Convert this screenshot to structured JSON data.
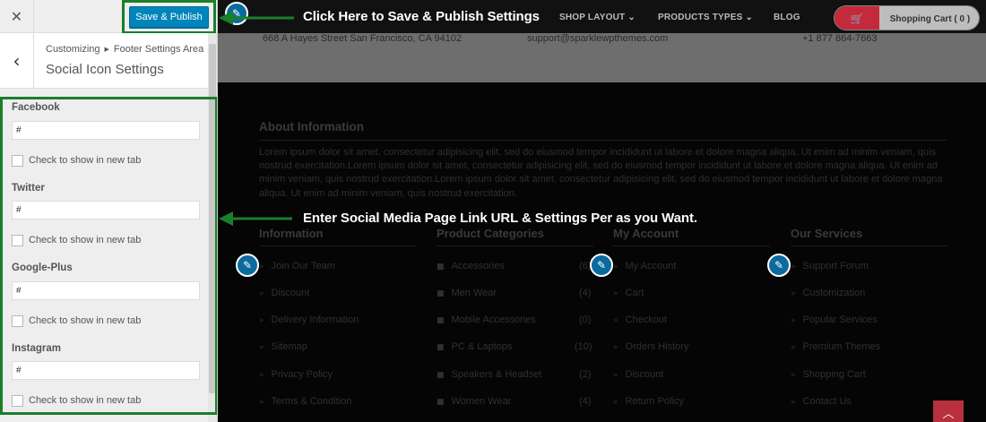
{
  "customizer": {
    "close_icon": "close-icon",
    "save_label": "Save & Publish",
    "breadcrumb": {
      "parent": "Customizing",
      "separator_icon": "triangle-right-icon",
      "section": "Footer Settings Area"
    },
    "section_title": "Social Icon Settings",
    "fields": [
      {
        "label": "Facebook",
        "value": "#",
        "checkbox_label": "Check to show in new tab"
      },
      {
        "label": "Twitter",
        "value": "#",
        "checkbox_label": "Check to show in new tab"
      },
      {
        "label": "Google-Plus",
        "value": "#",
        "checkbox_label": "Check to show in new tab"
      },
      {
        "label": "Instagram",
        "value": "#",
        "checkbox_label": "Check to show in new tab"
      }
    ]
  },
  "preview": {
    "nav": [
      "SHOP LAYOUT",
      "PRODUCTS TYPES",
      "BLOG"
    ],
    "cart_label": "Shopping Cart ( 0 )",
    "contact": {
      "address": "668 A Hayes Street San Francisco, CA 94102",
      "email": "support@sparklewpthemes.com",
      "phone": "+1 877 864-7663"
    },
    "about": {
      "title": "About Information",
      "text": "Lorem ipsum dolor sit amet, consectetur adipisicing elit, sed do eiusmod tempor incididunt ut labore et dolore magna aliqua. Ut enim ad minim veniam, quis nostrud exercitation.Lorem ipsum dolor sit amet, consectetur adipisicing elit, sed do eiusmod tempor incididunt ut labore et dolore magna aliqua. Ut enim ad minim veniam, quis nostrud exercitation.Lorem ipsum dolor sit amet, consectetur adipisicing elit, sed do eiusmod tempor incididunt ut labore et dolore magna aliqua. Ut enim ad minim veniam, quis nostrud exercitation."
    },
    "columns": {
      "information": {
        "title": "Information",
        "items": [
          "Join Our Team",
          "Discount",
          "Delivery Information",
          "Sitemap",
          "Privacy Policy",
          "Terms & Condition"
        ]
      },
      "product_categories": {
        "title": "Product Categories",
        "items": [
          "Accessories",
          "Men Wear",
          "Mobile Accessories",
          "PC & Laptops",
          "Speakers & Headset",
          "Women Wear"
        ],
        "counts": [
          "(6)",
          "(4)",
          "(0)",
          "(10)",
          "(2)",
          "(4)"
        ]
      },
      "my_account": {
        "title": "My Account",
        "items": [
          "My Account",
          "Cart",
          "Checkout",
          "Orders History",
          "Discount",
          "Return Policy"
        ]
      },
      "our_services": {
        "title": "Our Services",
        "items": [
          "Support Forum",
          "Customization",
          "Popular Services",
          "Premium Themes",
          "Shopping Cart",
          "Contact Us"
        ]
      }
    }
  },
  "annotations": {
    "save": "Click Here to Save & Publish Settings",
    "fields": "Enter Social Media Page Link URL & Settings Per as you Want."
  },
  "colors": {
    "accent_green": "#1a7f2a",
    "button_blue": "#0085ba",
    "cart_red": "#c42a3b"
  }
}
